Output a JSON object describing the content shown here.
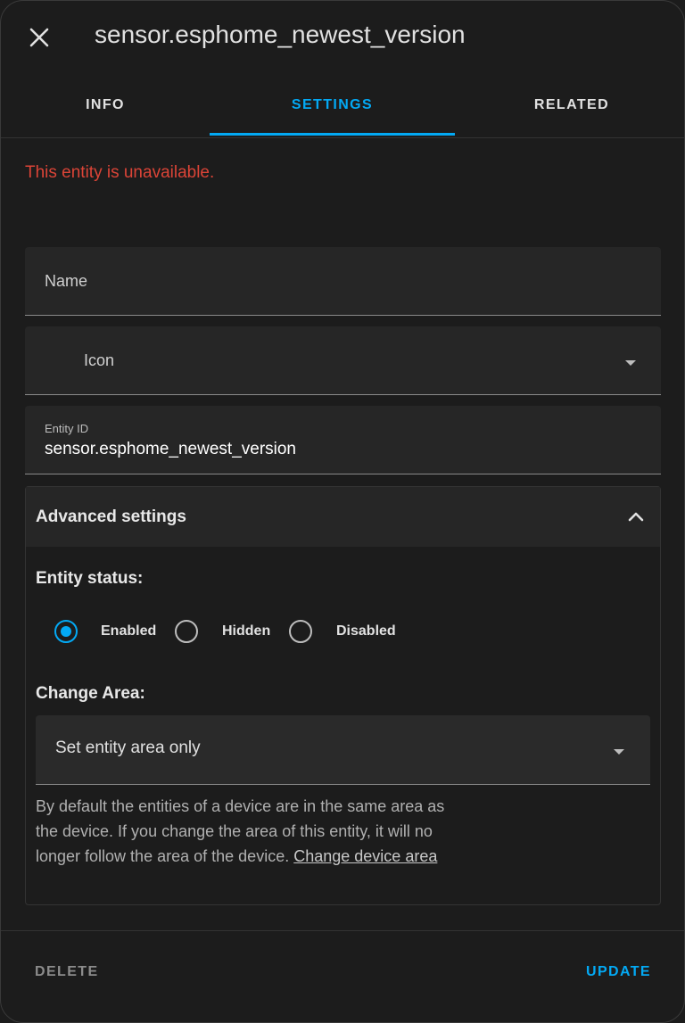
{
  "header": {
    "title": "sensor.esphome_newest_version"
  },
  "tabs": [
    {
      "label": "INFO"
    },
    {
      "label": "SETTINGS",
      "active": true
    },
    {
      "label": "RELATED"
    }
  ],
  "error_message": "This entity is unavailable.",
  "fields": {
    "name": {
      "label": "Name",
      "value": ""
    },
    "icon": {
      "label": "Icon",
      "value": ""
    },
    "entity_id": {
      "label": "Entity ID",
      "value": "sensor.esphome_newest_version"
    }
  },
  "advanced": {
    "title": "Advanced settings",
    "expanded": true,
    "entity_status_label": "Entity status:",
    "status_options": [
      {
        "label": "Enabled",
        "checked": true
      },
      {
        "label": "Hidden",
        "checked": false
      },
      {
        "label": "Disabled",
        "checked": false
      }
    ],
    "change_area_label": "Change Area:",
    "area_select_value": "Set entity area only",
    "helper_text": "By default the entities of a device are in the same area as the device. If you change the area of this entity, it will no longer follow the area of the",
    "helper_text_tail": "device.",
    "helper_link": "Change device area"
  },
  "footer": {
    "delete_label": "DELETE",
    "update_label": "UPDATE"
  },
  "colors": {
    "accent": "#03a9f4",
    "error": "#db4437",
    "background": "#1c1c1c"
  }
}
